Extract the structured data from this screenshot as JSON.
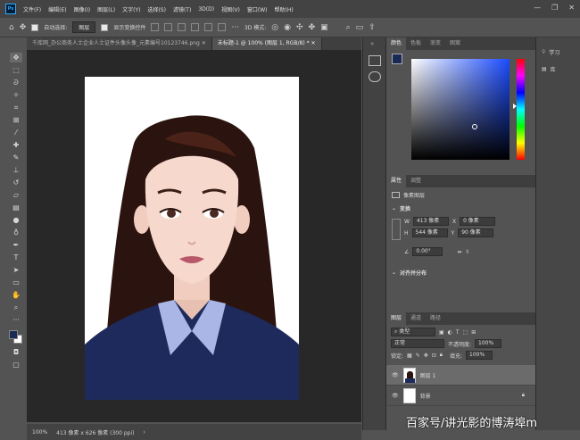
{
  "app": {
    "logo": "Ps"
  },
  "menu": [
    "文件(F)",
    "编辑(E)",
    "图像(I)",
    "图层(L)",
    "文字(Y)",
    "选择(S)",
    "滤镜(T)",
    "3D(D)",
    "视图(V)",
    "窗口(W)",
    "帮助(H)"
  ],
  "window_controls": [
    "—",
    "❐",
    "✕"
  ],
  "options": {
    "auto_select_label": "自动选择:",
    "auto_select_target": "图层",
    "show_transform_label": "显示变换控件",
    "mode_label": "3D 模式:"
  },
  "tabs": [
    {
      "label": "千库网_办公商务人士企业人士证件头像头像_元素编号10123746.png",
      "active": false
    },
    {
      "label": "未标题-1 @ 100% (图层 1, RGB/8) *",
      "active": true
    }
  ],
  "status": {
    "zoom": "100%",
    "doc_size": "413 像素 x 626 像素 (300 ppi)"
  },
  "color_panel": {
    "tabs": [
      "颜色",
      "色板",
      "渐变",
      "图案"
    ],
    "hue_color": "#1a4bff",
    "foreground": "#1a2a57",
    "background": "#ffffff"
  },
  "properties_panel": {
    "tabs": [
      "属性",
      "调整"
    ],
    "kind": "像素图层",
    "transform_heading": "变换",
    "w_label": "W",
    "w_value": "413 像素",
    "x_label": "X",
    "x_value": "0 像素",
    "h_label": "H",
    "h_value": "544 像素",
    "y_label": "Y",
    "y_value": "90 像素",
    "angle_value": "0.00°",
    "align_heading": "对齐并分布"
  },
  "layers_panel": {
    "tabs": [
      "图层",
      "通道",
      "路径"
    ],
    "filter_kind": "类型",
    "blend_mode": "正常",
    "opacity_label": "不透明度:",
    "opacity_value": "100%",
    "lock_label": "锁定:",
    "fill_label": "填充:",
    "fill_value": "100%",
    "layers": [
      {
        "name": "图层 1",
        "selected": true
      },
      {
        "name": "背景",
        "selected": false
      }
    ]
  },
  "learn_panel": {
    "learn_label": "学习",
    "library_label": "库"
  },
  "watermark": "百家号/讲光影的博涛埠m"
}
